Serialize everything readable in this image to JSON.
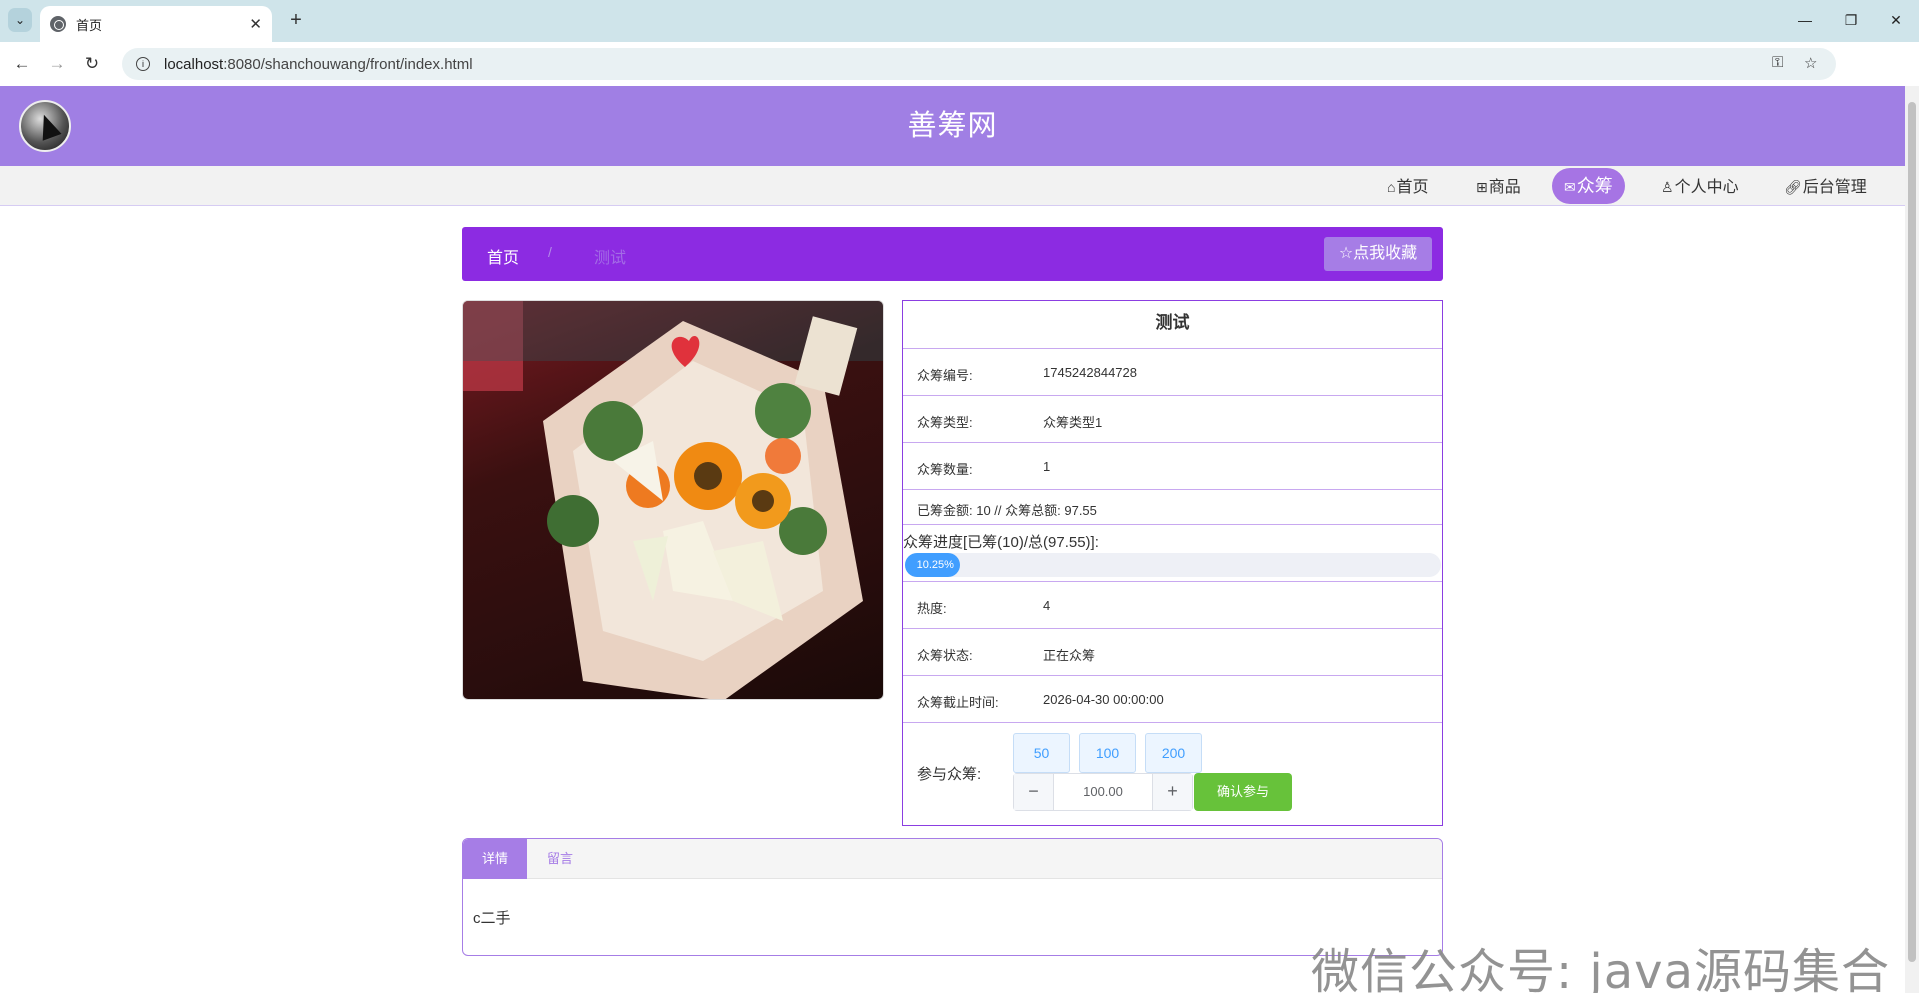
{
  "browser": {
    "tab_title": "首页",
    "url_host": "localhost",
    "url_rest": ":8080/shanchouwang/front/index.html"
  },
  "site": {
    "title": "善筹网",
    "nav": [
      {
        "label": "首页",
        "icon": "home-icon"
      },
      {
        "label": "商品",
        "icon": "gift-icon"
      },
      {
        "label": "众筹",
        "icon": "mail-icon",
        "active": true
      },
      {
        "label": "个人中心",
        "icon": "user-icon"
      },
      {
        "label": "后台管理",
        "icon": "link-icon"
      }
    ]
  },
  "breadcrumb": {
    "home": "首页",
    "separator": "/",
    "current": "测试",
    "collect_label": "☆点我收藏"
  },
  "product": {
    "title": "测试",
    "rows": [
      {
        "label": "众筹编号:",
        "value": "1745242844728"
      },
      {
        "label": "众筹类型:",
        "value": "众筹类型1"
      },
      {
        "label": "众筹数量:",
        "value": "1"
      }
    ],
    "raised_text": "已筹金额: 10 // 众筹总额: 97.55",
    "progress_label": "众筹进度[已筹(10)/总(97.55)]:",
    "progress_text": "10.25%",
    "progress_fraction": 0.1025,
    "rows2": [
      {
        "label": "热度:",
        "value": "4"
      },
      {
        "label": "众筹状态:",
        "value": "正在众筹"
      },
      {
        "label": "众筹截止时间:",
        "value": "2026-04-30 00:00:00"
      }
    ],
    "join": {
      "label": "参与众筹:",
      "chips": [
        "50",
        "100",
        "200"
      ],
      "minus": "−",
      "plus": "+",
      "amount": "100.00",
      "confirm_label": "确认参与"
    }
  },
  "detail": {
    "tab_detail": "详情",
    "tab_message": "留言",
    "content": "c二手"
  },
  "watermark": "微信公众号: java源码集合",
  "colors": {
    "header": "#a07fe4",
    "breadcrumb": "#8c2be2",
    "progress": "#409eff",
    "confirm": "#67c23a"
  }
}
